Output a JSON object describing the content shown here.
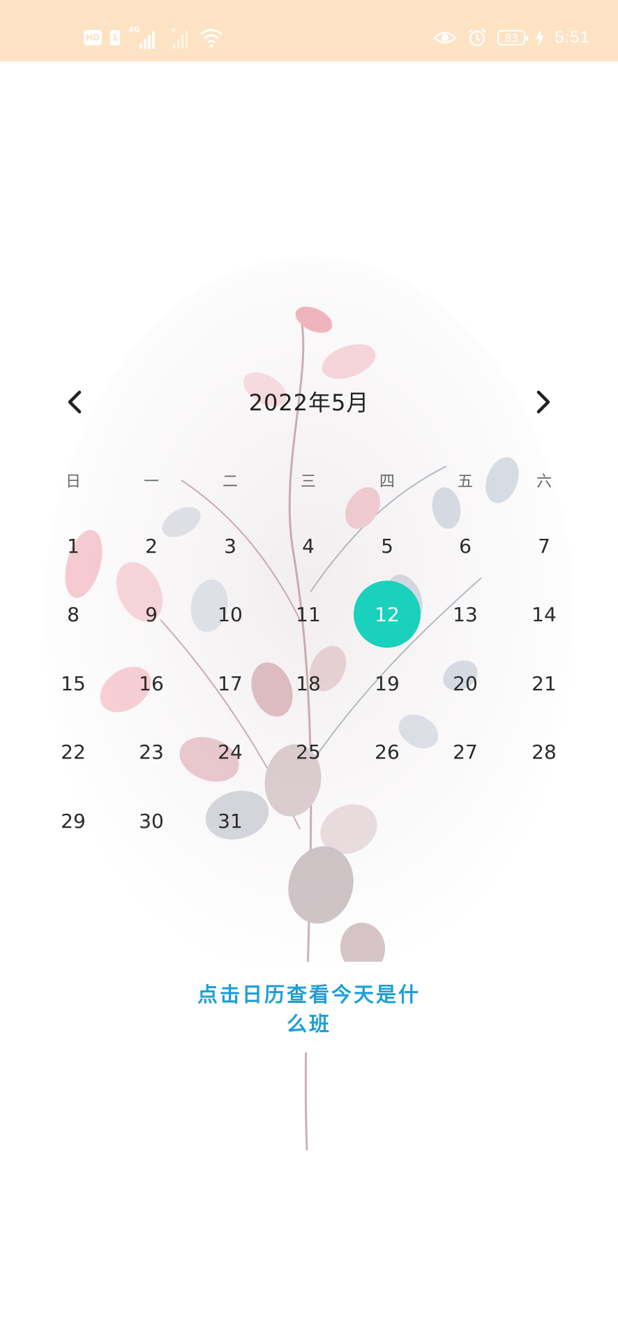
{
  "status_bar": {
    "hd_label": "HD",
    "sim_label": "1",
    "network_label": "4G",
    "battery_level": "83",
    "time": "5:51",
    "icons": [
      "hd-icon",
      "signal-icon",
      "no-signal-icon",
      "wifi-icon",
      "eye-icon",
      "alarm-icon",
      "battery-icon",
      "charging-icon"
    ]
  },
  "calendar": {
    "title": "2022年5月",
    "prev_icon": "chevron-left-icon",
    "next_icon": "chevron-right-icon",
    "weekdays": [
      "日",
      "一",
      "二",
      "三",
      "四",
      "五",
      "六"
    ],
    "weeks": [
      [
        "1",
        "2",
        "3",
        "4",
        "5",
        "6",
        "7"
      ],
      [
        "8",
        "9",
        "10",
        "11",
        "12",
        "13",
        "14"
      ],
      [
        "15",
        "16",
        "17",
        "18",
        "19",
        "20",
        "21"
      ],
      [
        "22",
        "23",
        "24",
        "25",
        "26",
        "27",
        "28"
      ],
      [
        "29",
        "30",
        "31"
      ]
    ],
    "selected_day": "12",
    "selected_color": "#19d1bd"
  },
  "hint": {
    "line1": "点击日历查看今天是什",
    "line2": "么班"
  }
}
